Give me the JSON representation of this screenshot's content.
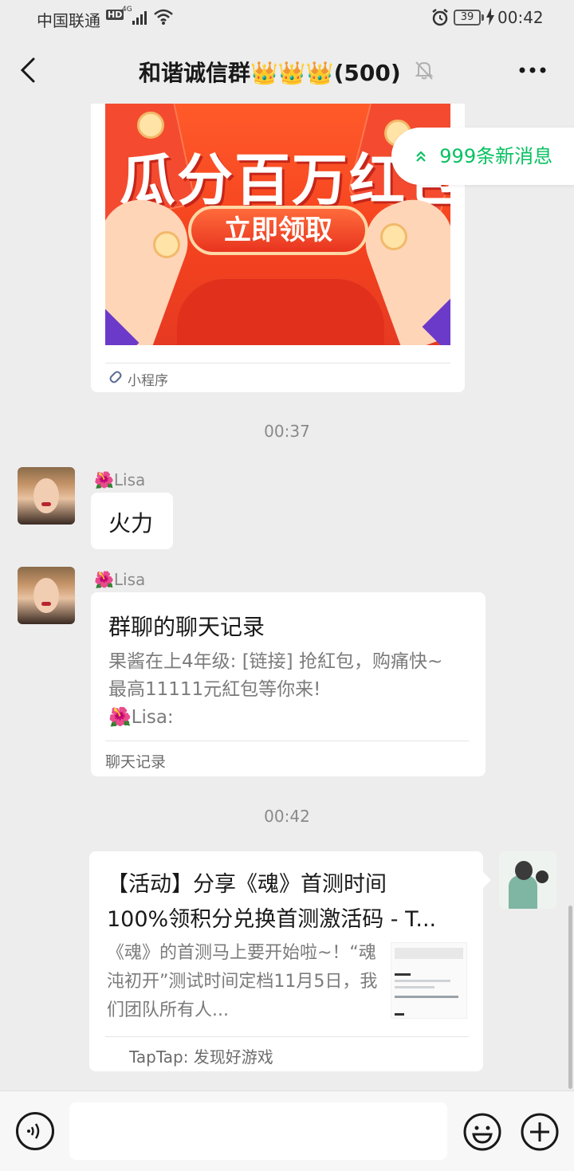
{
  "status_bar": {
    "carrier": "中国联通",
    "hd": "HD",
    "network": "4G",
    "battery": "39",
    "time": "00:42"
  },
  "header": {
    "title": "和谐诚信群👑👑👑(500)"
  },
  "new_messages": "999条新消息",
  "messages": {
    "mini_program": {
      "promo_text": "瓜分百万红包",
      "promo_button": "立即领取",
      "footer_label": "小程序"
    },
    "time_1": "00:37",
    "msg_1": {
      "sender": "🌺Lisa",
      "text": "火力"
    },
    "msg_2": {
      "sender": "🌺Lisa",
      "title": "群聊的聊天记录",
      "body": "果酱在上4年级: [链接] 抢紅包，购痛快~\n最高11111元紅包等你来!\n🌺Lisa:",
      "footer": "聊天记录"
    },
    "time_2": "00:42",
    "link_card": {
      "title_line1": "【活动】分享《魂》首测时间",
      "title_line2": "100%领积分兑换首测激活码 - T...",
      "description": "《魂》的首测马上要开始啦~！“魂沌初开”测试时间定档11月5日，我们团队所有人...",
      "source": "TapTap: 发现好游戏"
    }
  },
  "input_bar": {
    "placeholder": ""
  },
  "icons": {
    "back": "chevron-left-icon",
    "mute": "bell-mute-icon",
    "more": "more-dots-icon",
    "voice": "voice-icon",
    "emoji": "emoji-icon",
    "plus": "plus-icon",
    "mini_program": "mini-program-icon"
  },
  "colors": {
    "accent": "#07c160",
    "background": "#ededed",
    "promo_red": "#f5431f"
  }
}
